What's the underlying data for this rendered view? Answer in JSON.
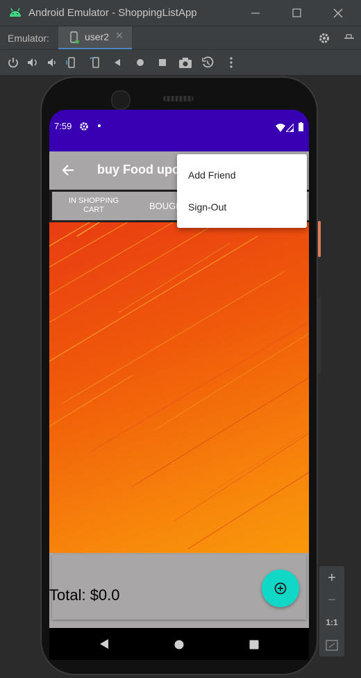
{
  "window": {
    "title": "Android Emulator - ShoppingListApp",
    "emulator_label": "Emulator:",
    "device_tab": "user2",
    "tab_close": "✕"
  },
  "right_panel": {
    "zoom_in": "+",
    "zoom_out": "−",
    "one_to_one": "1:1"
  },
  "status_bar": {
    "time": "7:59",
    "status_bg": "#3700b3"
  },
  "app_bar": {
    "title": "buy Food upc",
    "bg": "#a8a6a6"
  },
  "tabs": {
    "tab1": "IN SHOPPING\nCART",
    "tab1_line1": "IN SHOPPING",
    "tab1_line2": "CART",
    "tab2": "BOUGH"
  },
  "footer": {
    "total_text": "Total: $0.0",
    "fab_color": "#11d7c6"
  },
  "overflow_menu": {
    "items": [
      "Add Friend",
      "Sign-Out"
    ]
  },
  "icons": [
    "android-icon",
    "minimize-icon",
    "maximize-icon",
    "close-icon",
    "device-icon",
    "settings-icon",
    "pin-icon",
    "power-icon",
    "volume-up-icon",
    "volume-down-icon",
    "rotate-left-icon",
    "rotate-right-icon",
    "back-icon",
    "home-icon",
    "overview-icon",
    "camera-icon",
    "snapshot-icon",
    "more-icon",
    "back-arrow-icon",
    "wifi-icon",
    "signal-icon",
    "battery-icon",
    "add-circle-icon"
  ]
}
